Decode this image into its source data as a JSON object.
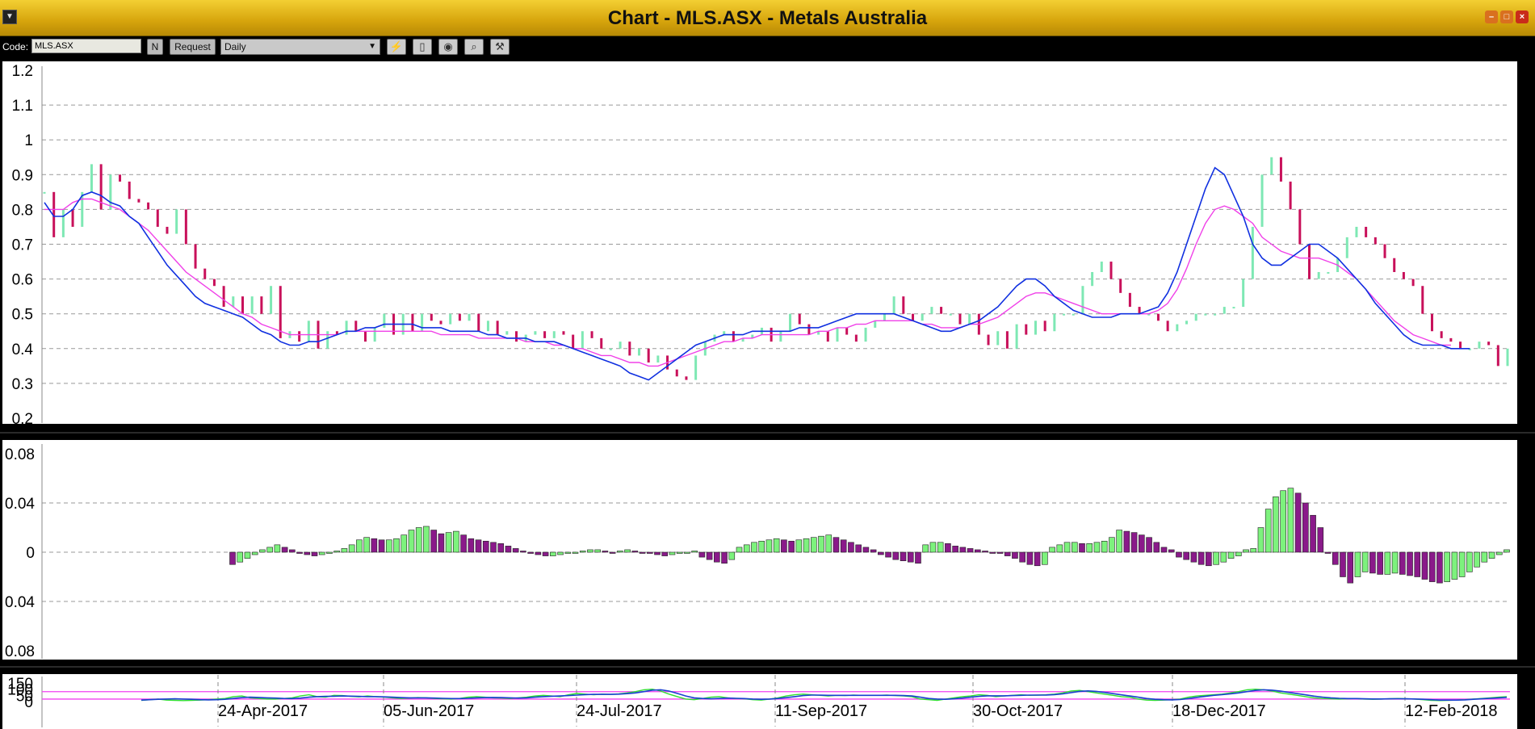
{
  "window": {
    "title": "Chart - MLS.ASX - Metals Australia",
    "menu_icon": "dropdown-icon",
    "min_icon": "minimize-icon",
    "max_icon": "maximize-icon",
    "close_icon": "close-icon"
  },
  "toolbar": {
    "code_label": "Code:",
    "code_value": "MLS.ASX",
    "n_label": "N",
    "request_label": "Request",
    "period_value": "Daily",
    "icons": [
      "indicator-icon",
      "page-icon",
      "color-icon",
      "zoom-icon",
      "tools-icon"
    ]
  },
  "colors": {
    "price_up": "#7ee8b4",
    "price_down": "#c8105a",
    "ma_short": "#1030e0",
    "ma_long": "#f040e8",
    "hist_pos": "#7df27d",
    "hist_neg": "#8a1a8a",
    "osc_k": "#30e030",
    "osc_d": "#1840d0",
    "osc_level": "#f040f0"
  },
  "chart_data": [
    {
      "type": "line",
      "panel": "price",
      "yticks": [
        "1.2",
        "1.1",
        "1",
        "0.9",
        "0.8",
        "0.7",
        "0.6",
        "0.5",
        "0.4",
        "0.3",
        "0.2"
      ],
      "ylim": [
        0.2,
        1.2
      ],
      "grid": true,
      "series": [
        {
          "name": "",
          "style": "close",
          "values": [
            0.85,
            0.72,
            0.8,
            0.75,
            0.85,
            0.93,
            0.8,
            0.9,
            0.88,
            0.83,
            0.82,
            0.8,
            0.75,
            0.73,
            0.8,
            0.7,
            0.63,
            0.6,
            0.58,
            0.52,
            0.55,
            0.5,
            0.55,
            0.5,
            0.58,
            0.43,
            0.45,
            0.42,
            0.48,
            0.4,
            0.45,
            0.44,
            0.48,
            0.45,
            0.42,
            0.46,
            0.5,
            0.44,
            0.5,
            0.45,
            0.5,
            0.48,
            0.47,
            0.5,
            0.48,
            0.5,
            0.45,
            0.48,
            0.44,
            0.45,
            0.42,
            0.44,
            0.45,
            0.43,
            0.45,
            0.44,
            0.4,
            0.45,
            0.43,
            0.4,
            0.4,
            0.42,
            0.38,
            0.4,
            0.36,
            0.38,
            0.34,
            0.32,
            0.31,
            0.38,
            0.42,
            0.44,
            0.45,
            0.42,
            0.43,
            0.44,
            0.46,
            0.42,
            0.45,
            0.5,
            0.47,
            0.44,
            0.45,
            0.42,
            0.46,
            0.44,
            0.42,
            0.46,
            0.48,
            0.5,
            0.55,
            0.5,
            0.48,
            0.5,
            0.52,
            0.5,
            0.5,
            0.47,
            0.5,
            0.44,
            0.41,
            0.45,
            0.4,
            0.47,
            0.44,
            0.48,
            0.45,
            0.5,
            0.5,
            0.5,
            0.58,
            0.62,
            0.65,
            0.6,
            0.56,
            0.52,
            0.5,
            0.5,
            0.48,
            0.45,
            0.47,
            0.48,
            0.5,
            0.5,
            0.5,
            0.52,
            0.52,
            0.6,
            0.75,
            0.9,
            0.95,
            0.88,
            0.8,
            0.7,
            0.6,
            0.62,
            0.62,
            0.66,
            0.72,
            0.75,
            0.72,
            0.7,
            0.66,
            0.62,
            0.6,
            0.58,
            0.5,
            0.45,
            0.43,
            0.42,
            0.4,
            0.4,
            0.42,
            0.41,
            0.35,
            0.4
          ]
        },
        {
          "name": "",
          "style": "short-ma",
          "values": [
            0.82,
            0.78,
            0.78,
            0.8,
            0.84,
            0.85,
            0.84,
            0.82,
            0.81,
            0.78,
            0.76,
            0.72,
            0.68,
            0.64,
            0.61,
            0.58,
            0.55,
            0.53,
            0.52,
            0.51,
            0.5,
            0.49,
            0.47,
            0.45,
            0.44,
            0.42,
            0.41,
            0.41,
            0.42,
            0.42,
            0.43,
            0.44,
            0.45,
            0.45,
            0.46,
            0.46,
            0.47,
            0.47,
            0.47,
            0.47,
            0.46,
            0.46,
            0.46,
            0.45,
            0.45,
            0.45,
            0.45,
            0.44,
            0.44,
            0.43,
            0.43,
            0.43,
            0.42,
            0.42,
            0.42,
            0.41,
            0.4,
            0.39,
            0.38,
            0.37,
            0.36,
            0.35,
            0.33,
            0.32,
            0.31,
            0.33,
            0.35,
            0.37,
            0.39,
            0.41,
            0.42,
            0.43,
            0.44,
            0.44,
            0.44,
            0.45,
            0.45,
            0.45,
            0.45,
            0.45,
            0.46,
            0.46,
            0.46,
            0.47,
            0.48,
            0.49,
            0.5,
            0.5,
            0.5,
            0.5,
            0.5,
            0.49,
            0.48,
            0.47,
            0.46,
            0.45,
            0.45,
            0.46,
            0.47,
            0.48,
            0.5,
            0.52,
            0.55,
            0.58,
            0.6,
            0.6,
            0.58,
            0.55,
            0.53,
            0.51,
            0.5,
            0.49,
            0.49,
            0.49,
            0.5,
            0.5,
            0.5,
            0.51,
            0.52,
            0.56,
            0.62,
            0.7,
            0.78,
            0.86,
            0.92,
            0.9,
            0.84,
            0.78,
            0.7,
            0.66,
            0.64,
            0.64,
            0.66,
            0.68,
            0.7,
            0.7,
            0.68,
            0.66,
            0.63,
            0.6,
            0.57,
            0.53,
            0.5,
            0.47,
            0.44,
            0.42,
            0.41,
            0.41,
            0.41,
            0.4,
            0.4,
            0.4
          ]
        },
        {
          "name": "",
          "style": "long-ma",
          "values": [
            0.8,
            0.8,
            0.8,
            0.82,
            0.83,
            0.83,
            0.82,
            0.81,
            0.8,
            0.78,
            0.76,
            0.74,
            0.71,
            0.68,
            0.65,
            0.62,
            0.6,
            0.58,
            0.56,
            0.54,
            0.52,
            0.5,
            0.49,
            0.47,
            0.46,
            0.45,
            0.44,
            0.44,
            0.44,
            0.44,
            0.44,
            0.44,
            0.45,
            0.45,
            0.45,
            0.45,
            0.45,
            0.45,
            0.45,
            0.45,
            0.45,
            0.45,
            0.44,
            0.44,
            0.44,
            0.44,
            0.43,
            0.43,
            0.43,
            0.43,
            0.43,
            0.42,
            0.42,
            0.42,
            0.41,
            0.41,
            0.4,
            0.4,
            0.39,
            0.38,
            0.38,
            0.37,
            0.36,
            0.36,
            0.35,
            0.35,
            0.36,
            0.37,
            0.38,
            0.39,
            0.4,
            0.41,
            0.42,
            0.42,
            0.43,
            0.43,
            0.44,
            0.44,
            0.44,
            0.44,
            0.44,
            0.44,
            0.45,
            0.45,
            0.46,
            0.46,
            0.47,
            0.47,
            0.48,
            0.48,
            0.48,
            0.48,
            0.48,
            0.47,
            0.47,
            0.46,
            0.46,
            0.46,
            0.47,
            0.47,
            0.48,
            0.49,
            0.51,
            0.53,
            0.55,
            0.56,
            0.56,
            0.55,
            0.54,
            0.53,
            0.52,
            0.51,
            0.5,
            0.5,
            0.5,
            0.5,
            0.5,
            0.5,
            0.51,
            0.53,
            0.57,
            0.63,
            0.7,
            0.76,
            0.8,
            0.81,
            0.8,
            0.78,
            0.76,
            0.72,
            0.7,
            0.68,
            0.67,
            0.66,
            0.66,
            0.66,
            0.65,
            0.64,
            0.62,
            0.6,
            0.57,
            0.54,
            0.51,
            0.48,
            0.46,
            0.44,
            0.43,
            0.42,
            0.41,
            0.41
          ]
        }
      ]
    },
    {
      "type": "bar",
      "panel": "histogram",
      "yticks": [
        "0.08",
        "0.04",
        "0",
        "0.04",
        "0.08"
      ],
      "ylim": [
        -0.08,
        0.08
      ],
      "grid": true,
      "values": [
        -0.01,
        -0.008,
        -0.005,
        -0.002,
        0.002,
        0.004,
        0.006,
        0.004,
        0.002,
        -0.001,
        -0.002,
        -0.003,
        -0.002,
        -0.001,
        0.001,
        0.003,
        0.006,
        0.01,
        0.012,
        0.011,
        0.01,
        0.01,
        0.011,
        0.014,
        0.018,
        0.02,
        0.021,
        0.018,
        0.015,
        0.016,
        0.017,
        0.014,
        0.011,
        0.01,
        0.009,
        0.008,
        0.007,
        0.005,
        0.003,
        0.001,
        -0.001,
        -0.002,
        -0.003,
        -0.003,
        -0.002,
        -0.001,
        0.0,
        0.001,
        0.002,
        0.002,
        0.001,
        0.0,
        0.001,
        0.002,
        0.001,
        0.0,
        -0.001,
        -0.002,
        -0.003,
        -0.002,
        -0.001,
        0.0,
        0.001,
        -0.004,
        -0.006,
        -0.008,
        -0.009,
        -0.006,
        0.004,
        0.006,
        0.008,
        0.009,
        0.01,
        0.011,
        0.01,
        0.009,
        0.01,
        0.011,
        0.012,
        0.013,
        0.014,
        0.012,
        0.01,
        0.008,
        0.006,
        0.004,
        0.002,
        -0.002,
        -0.004,
        -0.006,
        -0.007,
        -0.008,
        -0.009,
        0.006,
        0.008,
        0.008,
        0.007,
        0.005,
        0.004,
        0.003,
        0.002,
        0.001,
        0.0,
        -0.001,
        -0.003,
        -0.005,
        -0.008,
        -0.01,
        -0.011,
        -0.01,
        0.004,
        0.006,
        0.008,
        0.008,
        0.007,
        0.007,
        0.008,
        0.009,
        0.012,
        0.018,
        0.017,
        0.016,
        0.014,
        0.012,
        0.008,
        0.004,
        0.002,
        -0.004,
        -0.006,
        -0.008,
        -0.01,
        -0.011,
        -0.01,
        -0.008,
        -0.005,
        -0.003,
        0.002,
        0.003,
        0.02,
        0.035,
        0.045,
        0.05,
        0.052,
        0.048,
        0.04,
        0.03,
        0.02,
        0.0,
        -0.01,
        -0.02,
        -0.025,
        -0.02,
        -0.016,
        -0.017,
        -0.018,
        -0.018,
        -0.017,
        -0.018,
        -0.019,
        -0.02,
        -0.022,
        -0.024,
        -0.025,
        -0.024,
        -0.022,
        -0.02,
        -0.016,
        -0.012,
        -0.008,
        -0.005,
        -0.002,
        0.002
      ]
    },
    {
      "type": "line",
      "panel": "oscillator",
      "yticks": [
        "150",
        "100",
        "50",
        "0"
      ],
      "ylim": [
        0,
        150
      ],
      "levels": [
        80,
        20
      ],
      "x_dates": [
        "24-Apr-2017",
        "05-Jun-2017",
        "24-Jul-2017",
        "11-Sep-2017",
        "30-Oct-2017",
        "18-Dec-2017",
        "12-Feb-2018"
      ],
      "series": [
        {
          "name": "",
          "style": "k",
          "values": [
            10,
            15,
            20,
            12,
            10,
            8,
            10,
            12,
            15,
            20,
            25,
            40,
            45,
            30,
            25,
            20,
            20,
            25,
            30,
            45,
            55,
            40,
            35,
            50,
            48,
            42,
            38,
            45,
            40,
            35,
            30,
            25,
            28,
            32,
            30,
            25,
            22,
            20,
            25,
            35,
            40,
            35,
            30,
            28,
            25,
            30,
            35,
            45,
            50,
            45,
            40,
            55,
            65,
            60,
            55,
            60,
            58,
            62,
            70,
            80,
            95,
            100,
            85,
            60,
            40,
            20,
            15,
            25,
            35,
            40,
            30,
            25,
            22,
            15,
            12,
            20,
            30,
            45,
            55,
            60,
            55,
            50,
            45,
            50,
            48,
            52,
            50,
            50,
            50,
            52,
            48,
            45,
            40,
            20,
            15,
            10,
            20,
            30,
            40,
            45,
            55,
            50,
            40,
            45,
            50,
            55,
            50,
            52,
            55,
            60,
            70,
            85,
            90,
            80,
            70,
            60,
            50,
            40,
            35,
            20,
            12,
            10,
            12,
            15,
            20,
            35,
            45,
            50,
            55,
            60,
            70,
            80,
            95,
            100,
            95,
            85,
            70,
            60,
            50,
            40,
            30,
            25,
            22,
            20,
            22,
            25,
            20,
            18,
            20,
            22,
            25,
            22,
            20,
            15,
            10,
            8,
            10,
            12,
            15,
            20,
            25,
            30,
            35,
            40
          ]
        },
        {
          "name": "",
          "style": "d",
          "values": [
            12,
            15,
            18,
            20,
            22,
            20,
            18,
            15,
            14,
            15,
            18,
            25,
            32,
            35,
            33,
            30,
            28,
            25,
            24,
            28,
            35,
            40,
            42,
            43,
            45,
            44,
            42,
            40,
            40,
            38,
            35,
            32,
            30,
            30,
            30,
            28,
            26,
            24,
            24,
            26,
            30,
            32,
            33,
            32,
            30,
            28,
            30,
            35,
            40,
            43,
            45,
            48,
            52,
            56,
            58,
            58,
            58,
            60,
            64,
            70,
            80,
            92,
            95,
            85,
            65,
            45,
            30,
            25,
            22,
            25,
            28,
            26,
            24,
            20,
            18,
            20,
            25,
            32,
            40,
            48,
            52,
            52,
            50,
            50,
            50,
            50,
            50,
            50,
            50,
            50,
            50,
            48,
            45,
            35,
            25,
            20,
            18,
            22,
            28,
            35,
            42,
            46,
            46,
            46,
            48,
            50,
            52,
            52,
            53,
            56,
            62,
            72,
            82,
            86,
            82,
            74,
            64,
            54,
            45,
            35,
            25,
            18,
            15,
            14,
            16,
            24,
            34,
            42,
            50,
            56,
            62,
            70,
            80,
            90,
            95,
            92,
            84,
            74,
            64,
            54,
            44,
            36,
            30,
            26,
            24,
            24,
            22,
            21,
            21,
            22,
            23,
            22,
            21,
            18,
            15,
            12,
            12,
            12,
            14,
            18,
            22,
            26,
            30,
            34
          ]
        }
      ]
    }
  ]
}
